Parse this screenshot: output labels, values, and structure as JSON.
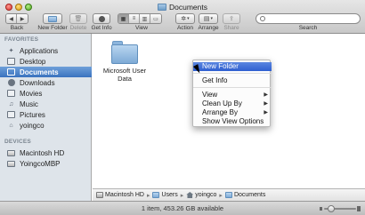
{
  "window": {
    "title": "Documents"
  },
  "toolbar": {
    "back_label": "Back",
    "new_folder_label": "New Folder",
    "delete_label": "Delete",
    "get_info_label": "Get Info",
    "view_label": "View",
    "action_label": "Action",
    "arrange_label": "Arrange",
    "share_label": "Share",
    "search_label": "Search",
    "search_value": "",
    "search_placeholder": ""
  },
  "sidebar": {
    "favorites_heading": "FAVORITES",
    "devices_heading": "DEVICES",
    "favorites": [
      {
        "label": "Applications",
        "icon": "applications-icon"
      },
      {
        "label": "Desktop",
        "icon": "desktop-icon"
      },
      {
        "label": "Documents",
        "icon": "documents-icon",
        "selected": true
      },
      {
        "label": "Downloads",
        "icon": "downloads-icon"
      },
      {
        "label": "Movies",
        "icon": "movies-icon"
      },
      {
        "label": "Music",
        "icon": "music-icon"
      },
      {
        "label": "Pictures",
        "icon": "pictures-icon"
      },
      {
        "label": "yoingco",
        "icon": "home-icon"
      }
    ],
    "devices": [
      {
        "label": "Macintosh HD",
        "icon": "hard-disk-icon"
      },
      {
        "label": "YoingcoMBP",
        "icon": "computer-icon"
      }
    ]
  },
  "files": [
    {
      "name": "Microsoft User Data",
      "kind": "folder"
    }
  ],
  "context_menu": {
    "items": [
      {
        "label": "New Folder",
        "highlighted": true
      },
      {
        "label": "Get Info"
      },
      {
        "label": "View",
        "submenu": true
      },
      {
        "label": "Clean Up By",
        "submenu": true
      },
      {
        "label": "Arrange By",
        "submenu": true
      },
      {
        "label": "Show View Options"
      }
    ]
  },
  "path_bar": {
    "segments": [
      "Macintosh HD",
      "Users",
      "yoingco",
      "Documents"
    ]
  },
  "status": {
    "text": "1 item, 453.26 GB available"
  },
  "colors": {
    "selection": "#3a72bf",
    "menu_highlight": "#2f5fd0",
    "sidebar_bg": "#dee4ea"
  }
}
